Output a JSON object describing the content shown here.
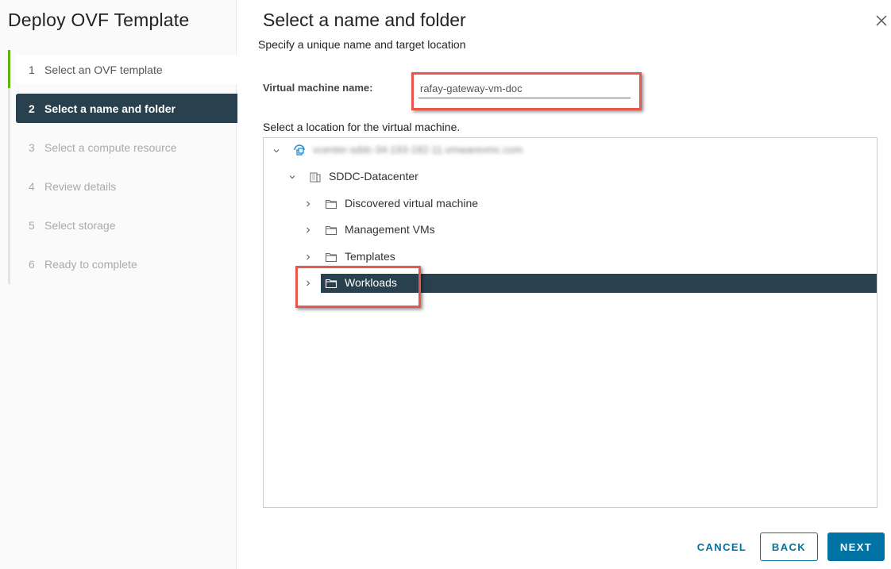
{
  "wizard": {
    "title": "Deploy OVF Template",
    "steps": [
      {
        "number": "1",
        "label": "Select an OVF template",
        "state": "done"
      },
      {
        "number": "2",
        "label": "Select a name and folder",
        "state": "active"
      },
      {
        "number": "3",
        "label": "Select a compute resource",
        "state": "pending"
      },
      {
        "number": "4",
        "label": "Review details",
        "state": "pending"
      },
      {
        "number": "5",
        "label": "Select storage",
        "state": "pending"
      },
      {
        "number": "6",
        "label": "Ready to complete",
        "state": "pending"
      }
    ]
  },
  "page": {
    "title": "Select a name and folder",
    "subtitle": "Specify a unique name and target location",
    "vm_name_label": "Virtual machine name:",
    "vm_name_value": "rafay-gateway-vm-doc",
    "location_label": "Select a location for the virtual machine."
  },
  "tree": {
    "root": {
      "label": "vcenter-sddc-34-193-182-11.vmwarevmc.com",
      "icon": "vcenter-icon",
      "expanded": true,
      "blurred": true
    },
    "datacenter": {
      "label": "SDDC-Datacenter",
      "icon": "datacenter-icon",
      "expanded": true
    },
    "folders": [
      {
        "label": "Discovered virtual machine",
        "icon": "folder-icon",
        "selected": false
      },
      {
        "label": "Management VMs",
        "icon": "folder-icon",
        "selected": false
      },
      {
        "label": "Templates",
        "icon": "folder-icon",
        "selected": false
      },
      {
        "label": "Workloads",
        "icon": "folder-icon",
        "selected": true
      }
    ]
  },
  "footer": {
    "cancel_label": "CANCEL",
    "back_label": "BACK",
    "next_label": "NEXT"
  },
  "colors": {
    "accent": "#0072a3",
    "active_step": "#29414e",
    "progress": "#60b515",
    "annotation": "#e8574b"
  }
}
